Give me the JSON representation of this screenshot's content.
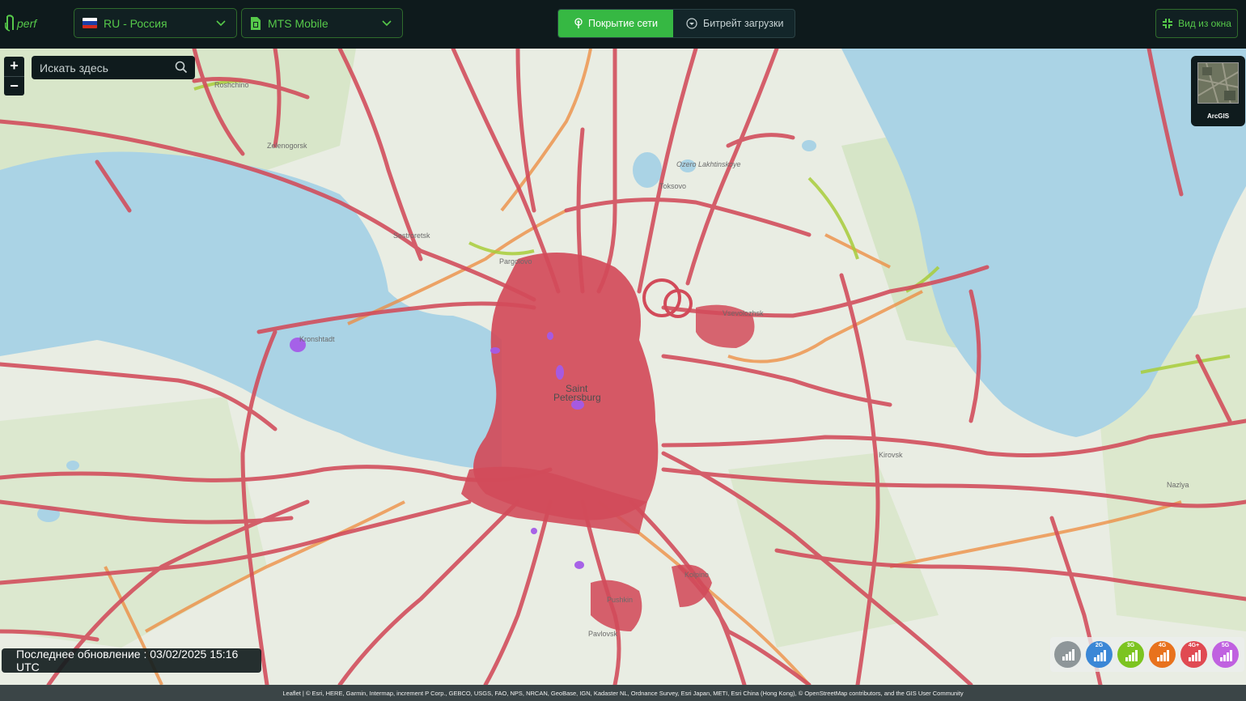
{
  "header": {
    "country": {
      "label": "RU - Россия",
      "flag_colors": [
        "#ffffff",
        "#1c3fa8",
        "#d52b1e"
      ]
    },
    "operator": {
      "label": "MTS Mobile"
    },
    "tabs": [
      {
        "label": "Покрытие сети",
        "active": true,
        "icon": "tower-icon"
      },
      {
        "label": "Битрейт загрузки",
        "active": false,
        "icon": "download-circle-icon"
      }
    ],
    "view_button": {
      "label": "Вид из окна",
      "icon": "collapse-icon"
    }
  },
  "map": {
    "search_placeholder": "Искать здесь",
    "zoom_in": "+",
    "zoom_out": "−",
    "basemap": {
      "label": "ArcGIS"
    },
    "places": [
      {
        "name": "Roshchino"
      },
      {
        "name": "Zelenogorsk"
      },
      {
        "name": "Sestroretsk"
      },
      {
        "name": "Pargolovo"
      },
      {
        "name": "Kronshtadt"
      },
      {
        "name": "Saint"
      },
      {
        "name": "Petersburg"
      },
      {
        "name": "Vsevolozhsk"
      },
      {
        "name": "Kirovsk"
      },
      {
        "name": "Nazlya"
      },
      {
        "name": "Kolpino"
      },
      {
        "name": "Pushkin"
      },
      {
        "name": "Pavlovsk"
      },
      {
        "name": "Toksovo"
      },
      {
        "name": "Ozero Lakhtinskoye"
      }
    ],
    "status_text": "Последнее обновление : 03/02/2025 15:16 UTC",
    "legend": [
      {
        "label": "",
        "color": "#8e9699",
        "icon": "signal-off-icon"
      },
      {
        "label": "2G",
        "color": "#3b87d6",
        "icon": "signal-2g-icon"
      },
      {
        "label": "3G",
        "color": "#7cc420",
        "icon": "signal-3g-icon"
      },
      {
        "label": "4G",
        "color": "#e8721d",
        "icon": "signal-4g-icon"
      },
      {
        "label": "4G+",
        "color": "#e04a52",
        "icon": "signal-4gplus-icon"
      },
      {
        "label": "5G",
        "color": "#c061e0",
        "icon": "signal-5g-icon"
      }
    ],
    "attribution": "Leaflet | © Esri, HERE, Garmin, Intermap, increment P Corp., GEBCO, USGS, FAO, NPS, NRCAN, GeoBase, IGN, Kadaster NL, Ordnance Survey, Esri Japan, METI, Esri China (Hong Kong), © OpenStreetMap contributors, and the GIS User Community",
    "colors": {
      "water": "#aad3e5",
      "land": "#e8ece1",
      "coverage_4gplus": "#d24b5a",
      "coverage_4g": "#ee8a3c",
      "coverage_3g": "#a8cc3a",
      "coverage_5g": "#a45be8"
    }
  }
}
